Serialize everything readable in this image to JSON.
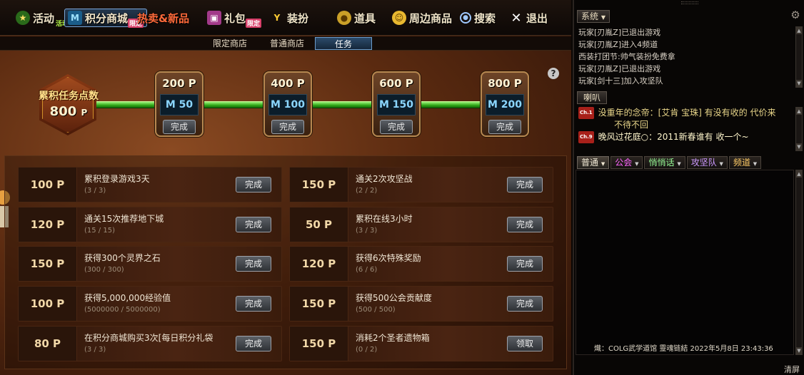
{
  "nav": {
    "items": [
      {
        "label": "活动",
        "tag": "活动",
        "icon": "star-icon"
      },
      {
        "label": "积分商城",
        "tag": "限定",
        "icon": "m-icon"
      },
      {
        "label": "热卖&新品",
        "tag": "",
        "icon": ""
      },
      {
        "label": "礼包",
        "tag": "限定",
        "icon": "gift-icon"
      },
      {
        "label": "装扮",
        "tag": "",
        "icon": "trophy-icon"
      },
      {
        "label": "道具",
        "tag": "",
        "icon": "coin-icon"
      },
      {
        "label": "周边商品",
        "tag": "",
        "icon": "smiley-icon"
      },
      {
        "label": "搜索",
        "tag": "",
        "icon": "search-icon"
      },
      {
        "label": "退出",
        "tag": "",
        "icon": "close-icon"
      }
    ]
  },
  "subtabs": [
    "限定商店",
    "普通商店",
    "任务"
  ],
  "progress": {
    "title": "累积任务点数",
    "points": "800",
    "unit": "P",
    "milestones": [
      {
        "pts": "200 P",
        "reward": "M 50",
        "button": "完成"
      },
      {
        "pts": "400 P",
        "reward": "M 100",
        "button": "完成"
      },
      {
        "pts": "600 P",
        "reward": "M 150",
        "button": "完成"
      },
      {
        "pts": "800 P",
        "reward": "M 200",
        "button": "完成"
      }
    ],
    "help": "?"
  },
  "tasks": [
    {
      "pts": "100 P",
      "name": "累积登录游戏3天",
      "prog": "(3 / 3)",
      "button": "完成"
    },
    {
      "pts": "150 P",
      "name": "通关2次攻坚战",
      "prog": "(2 / 2)",
      "button": "完成"
    },
    {
      "pts": "120 P",
      "name": "通关15次推荐地下城",
      "prog": "(15 / 15)",
      "button": "完成"
    },
    {
      "pts": "50 P",
      "name": "累积在线3小时",
      "prog": "(3 / 3)",
      "button": "完成"
    },
    {
      "pts": "150 P",
      "name": "获得300个灵界之石",
      "prog": "(300 / 300)",
      "button": "完成"
    },
    {
      "pts": "120 P",
      "name": "获得6次特殊奖励",
      "prog": "(6 / 6)",
      "button": "完成"
    },
    {
      "pts": "100 P",
      "name": "获得5,000,000经验值",
      "prog": "(5000000 / 5000000)",
      "button": "完成"
    },
    {
      "pts": "150 P",
      "name": "获得500公会贡献度",
      "prog": "(500 / 500)",
      "button": "完成"
    },
    {
      "pts": "80 P",
      "name": "在积分商城购买3次[每日积分礼袋",
      "prog": "(3 / 3)",
      "button": "完成"
    },
    {
      "pts": "150 P",
      "name": "消耗2个圣者遗物箱",
      "prog": "(0 / 2)",
      "button": "领取"
    }
  ],
  "chat": {
    "system_label": "系统",
    "system_log": [
      "玩家[刃胤Z]已退出游戏",
      "玩家[刃胤Z]进入4频道",
      "西装打团节:帅气装扮免费拿",
      "玩家[刃胤Z]已退出游戏",
      "玩家[剑十三]加入攻坚队"
    ],
    "horn_label": "喇叭",
    "horn_log": [
      {
        "ch": "Ch.1",
        "text": "没重年的念帝：[艾肯 宝珠] 有没有收的  代价来"
      },
      {
        "ch": "",
        "text": "不待不回"
      },
      {
        "ch": "Ch.9",
        "text": "晚风过花庭○：2011新春谁有 收一个~"
      }
    ],
    "tabs": [
      "普通",
      "公会",
      "悄悄话",
      "攻坚队",
      "频道"
    ],
    "tab_colors": [
      "#ffffff",
      "#ff66ff",
      "#99ff99",
      "#cc99ff",
      "#ffcc66"
    ],
    "message": "熾：COLG武学道馆 靈魂链結 2022年5月8日 23:43:36",
    "clear": "清屏"
  }
}
